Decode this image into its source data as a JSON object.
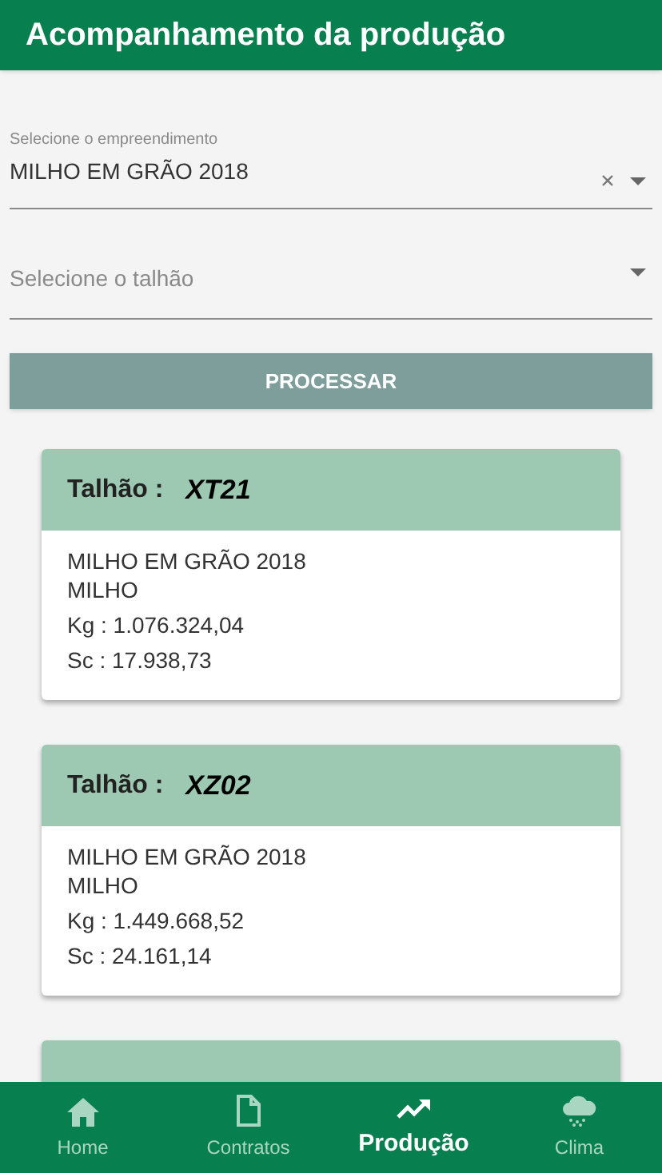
{
  "app_bar": {
    "title": "Acompanhamento da produção"
  },
  "filters": [
    {
      "kind": "select",
      "label": "Selecione o empreendimento",
      "value": "MILHO EM GRÃO 2018",
      "clearable": true
    },
    {
      "kind": "select",
      "placeholder": "Selecione o talhão",
      "clearable": false
    }
  ],
  "process_button": {
    "label": "PROCESSAR"
  },
  "cards": [
    {
      "kind": "full",
      "label": "Talhão :",
      "value": "XT21",
      "lines": [
        "MILHO EM GRÃO 2018",
        "MILHO",
        "Kg : 1.076.324,04",
        "Sc : 17.938,73"
      ]
    },
    {
      "kind": "full",
      "label": "Talhão :",
      "value": "XZ02",
      "lines": [
        "MILHO EM GRÃO 2018",
        "MILHO",
        "Kg : 1.449.668,52",
        "Sc : 24.161,14"
      ]
    },
    {
      "kind": "covered"
    }
  ],
  "bottom_nav": [
    {
      "label": "Home",
      "selected": false
    },
    {
      "label": "Contratos",
      "selected": false
    },
    {
      "label": "Produção",
      "selected": true
    },
    {
      "label": "Clima",
      "selected": false
    }
  ]
}
